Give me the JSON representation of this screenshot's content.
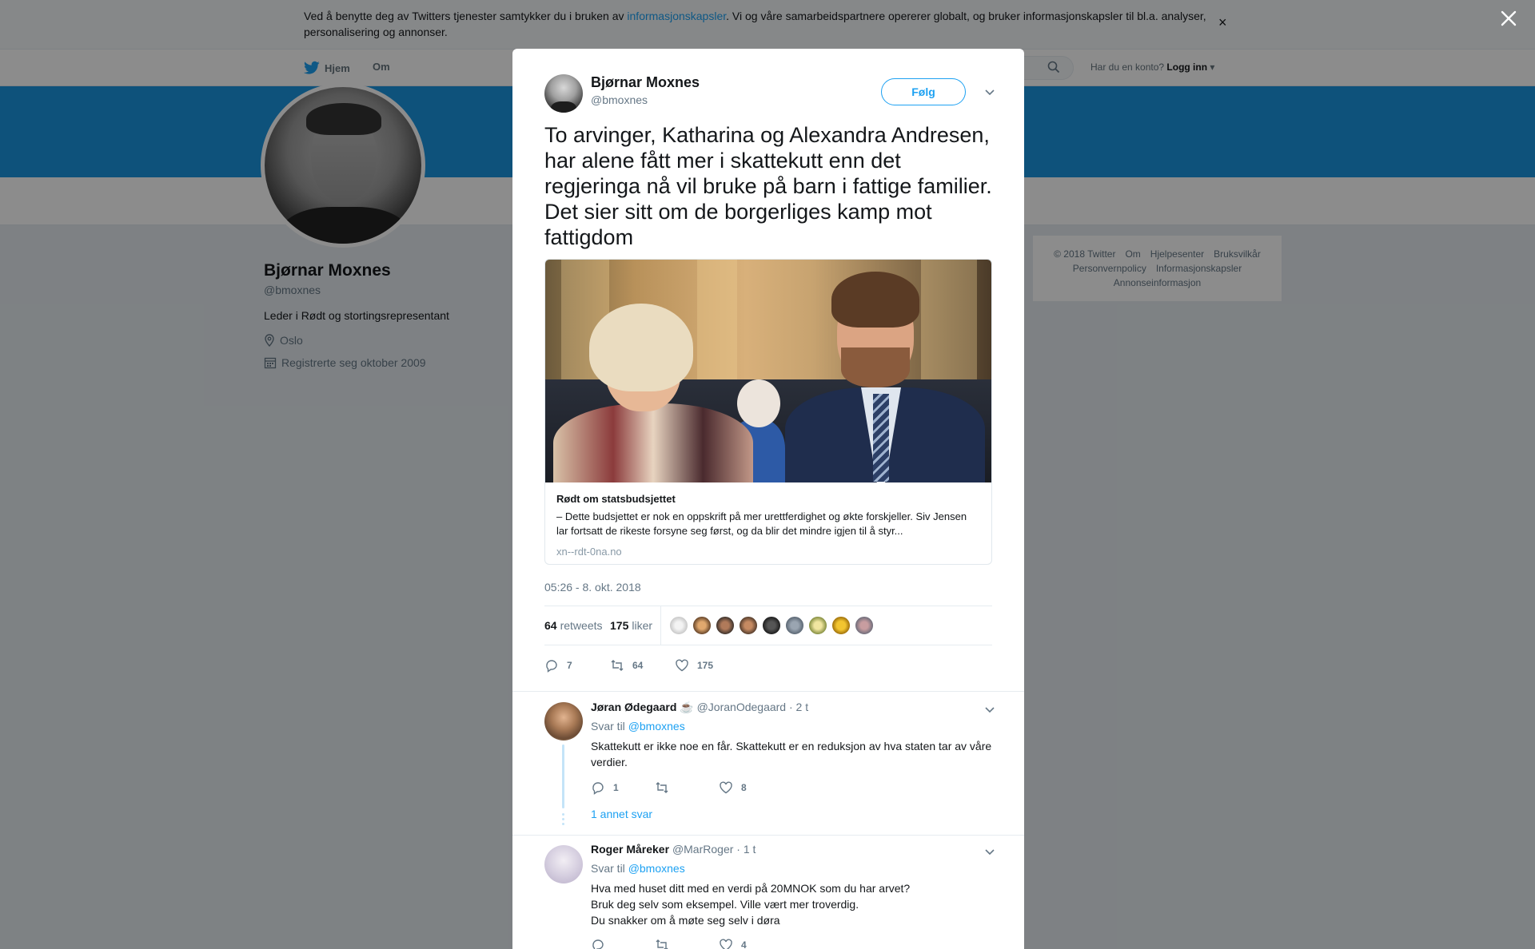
{
  "cookie_banner": {
    "text_before": "Ved å benytte deg av Twitters tjenester samtykker du i bruken av ",
    "link": "informasjonskapsler",
    "text_after": ". Vi og våre samarbeidspartnere opererer globalt, og bruker informasjonskapsler til bl.a. analyser, personalisering og annonser.",
    "close": "×"
  },
  "nav": {
    "home": "Hjem",
    "about": "Om",
    "account_prompt": "Har du en konto?",
    "login": "Logg inn"
  },
  "profile": {
    "name": "Bjørnar Moxnes",
    "handle": "@bmoxnes",
    "bio": "Leder i Rødt og stortingsrepresentant",
    "location": "Oslo",
    "joined": "Registrerte seg oktober 2009"
  },
  "footer": {
    "links": [
      "© 2018 Twitter",
      "Om",
      "Hjelpesenter",
      "Bruksvilkår",
      "Personvernpolicy",
      "Informasjonskapsler",
      "Annonseinformasjon"
    ]
  },
  "tweet": {
    "author_name": "Bjørnar Moxnes",
    "author_handle": "@bmoxnes",
    "follow_label": "Følg",
    "text": "To arvinger, Katharina og Alexandra Andresen, har alene fått mer i skattekutt enn det regjeringa nå vil bruke på barn i fattige familier. Det sier sitt om de borgerliges kamp mot fattigdom",
    "card": {
      "title": "Rødt om statsbudsjettet",
      "description": "– Dette budsjettet er nok en oppskrift på mer urettferdighet og økte forskjeller. Siv Jensen lar fortsatt de rikeste forsyne seg først, og da blir det mindre igjen til å styr...",
      "domain": "xn--rdt-0na.no"
    },
    "timestamp": "05:26 - 8. okt. 2018",
    "retweets_count": "64",
    "retweets_label": "retweets",
    "likes_count": "175",
    "likes_label": "liker",
    "actions": {
      "replies": "7",
      "retweets": "64",
      "likes": "175"
    }
  },
  "replies": [
    {
      "name": "Jøran Ødegaard",
      "emoji": "☕",
      "handle": "@JoranOdegaard",
      "time": "· 2 t",
      "reply_to_label": "Svar til",
      "reply_to": "@bmoxnes",
      "text": "Skattekutt er ikke noe en får. Skattekutt er en reduksjon av hva staten tar av våre verdier.",
      "replies": "1",
      "retweets": "",
      "likes": "8",
      "more": "1 annet svar"
    },
    {
      "name": "Roger Måreker",
      "handle": "@MarRoger",
      "time": "· 1 t",
      "reply_to_label": "Svar til",
      "reply_to": "@bmoxnes",
      "text_lines": [
        "Hva med huset ditt med en verdi på 20MNOK som du har arvet?",
        "Bruk deg selv som eksempel. Ville vært mer troverdig.",
        "Du snakker om å møte seg selv i døra"
      ],
      "replies": "",
      "retweets": "",
      "likes": "4"
    }
  ],
  "colors": {
    "accent": "#1da1f2",
    "banner": "#1b95e0",
    "text_secondary": "#657786"
  }
}
